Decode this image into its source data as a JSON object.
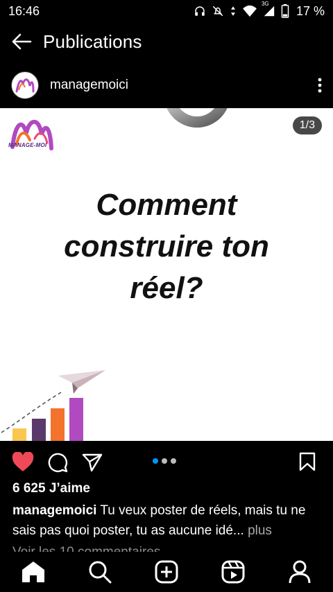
{
  "status_bar": {
    "time": "16:46",
    "battery": "17 %",
    "network": "3G",
    "icons": [
      "headphones-icon",
      "mute-icon",
      "data-arrows-icon",
      "wifi-icon",
      "signal-icon",
      "battery-icon"
    ]
  },
  "app_bar": {
    "back_icon": "arrow-left-icon",
    "title": "Publications"
  },
  "post": {
    "username": "managemoici",
    "more_icon": "more-vertical-icon",
    "page_counter": "1/3",
    "image": {
      "brand_name": "MANAGE-MOI",
      "headline": [
        "Comment",
        "construire ton",
        "réel?"
      ],
      "bar_colors": [
        "#f9c74f",
        "#5a3a6b",
        "#f3722c",
        "#b14ac0"
      ]
    },
    "likes": "6 625 J’aime",
    "caption_user": "managemoici",
    "caption_text": "Tu veux poster de réels, mais tu ne sais pas quoi poster, tu as aucune idé...",
    "caption_more": "plus",
    "comments_link": "Voir les 10 commentaires",
    "liked_color": "#ed4956",
    "carousel_active_color": "#0095f6"
  },
  "actions": [
    "heart-icon",
    "comment-icon",
    "share-icon",
    "bookmark-icon"
  ],
  "bottom_nav": [
    "home-icon",
    "search-icon",
    "create-icon",
    "reels-icon",
    "profile-icon"
  ]
}
